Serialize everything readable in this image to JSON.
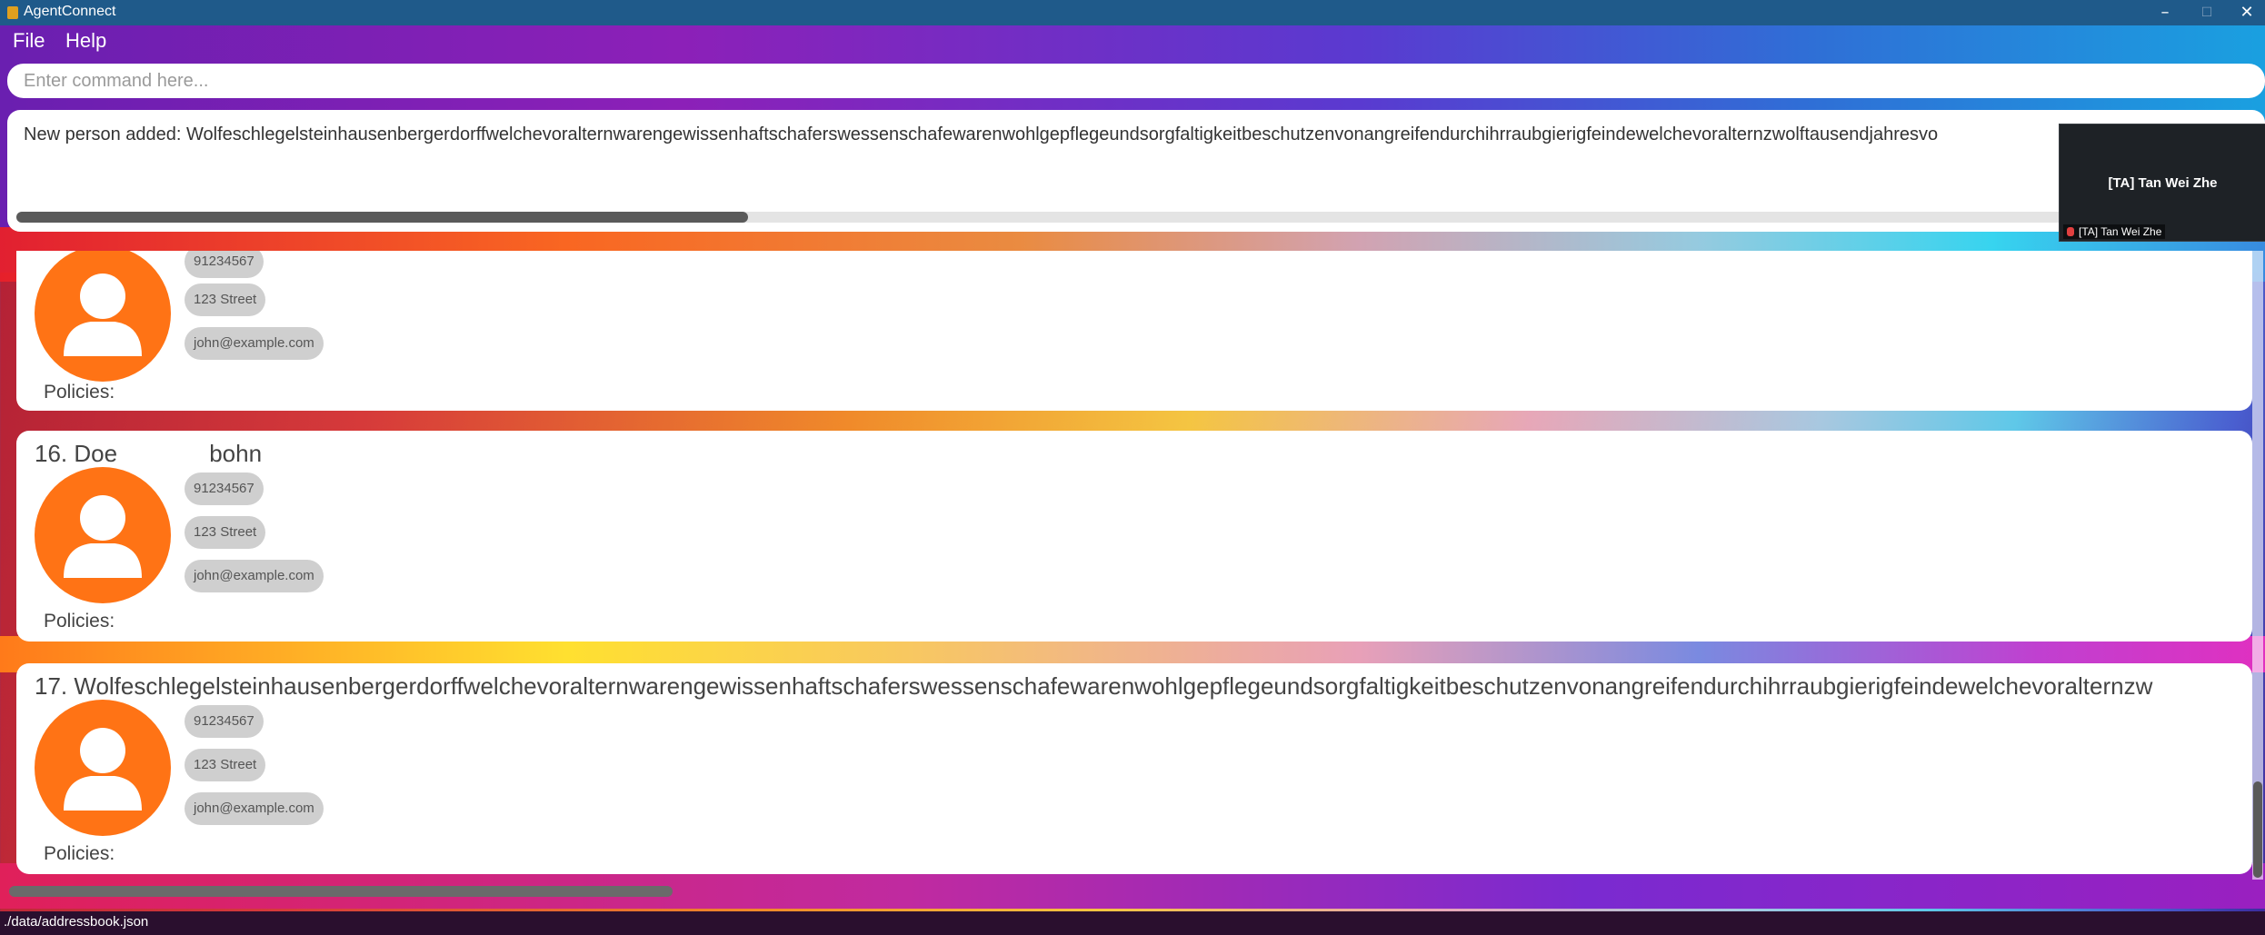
{
  "window": {
    "title": "AgentConnect",
    "minimize": "–",
    "maximize": "☐",
    "close": "✕"
  },
  "menu": [
    {
      "label": "File"
    },
    {
      "label": "Help"
    }
  ],
  "command": {
    "placeholder": "Enter command here...",
    "value": ""
  },
  "result": {
    "message": "New person added: Wolfeschlegelsteinhausenbergerdorffwelchevoralternwarengewissenhaftschaferswessenschafewarenwohlgepflegeundsorgfaltigkeitbeschutzenvonangreifendurchihrraubgierigfeindewelchevoralternzwolftausendjahresvo"
  },
  "video_overlay": {
    "name": "[TA] Tan Wei Zhe",
    "footer": "[TA] Tan Wei Zhe"
  },
  "persons": [
    {
      "title": "",
      "phone": "91234567",
      "address": "123 Street",
      "email": "john@example.com",
      "policies_label": "Policies:"
    },
    {
      "title": "16. Doe              bohn",
      "phone": "91234567",
      "address": "123 Street",
      "email": "john@example.com",
      "policies_label": "Policies:"
    },
    {
      "title": "17. Wolfeschlegelsteinhausenbergerdorffwelchevoralternwarengewissenhaftschaferswessenschafewarenwohlgepflegeundsorgfaltigkeitbeschutzenvonangreifendurchihrraubgierigfeindewelchevoralternzw",
      "phone": "91234567",
      "address": "123 Street",
      "email": "john@example.com",
      "policies_label": "Policies:"
    }
  ],
  "status": {
    "path": "./data/addressbook.json"
  },
  "colors": {
    "accent": "#ff7315",
    "titlebar": "#1f5a8a",
    "tag": "#cfcfcf"
  }
}
